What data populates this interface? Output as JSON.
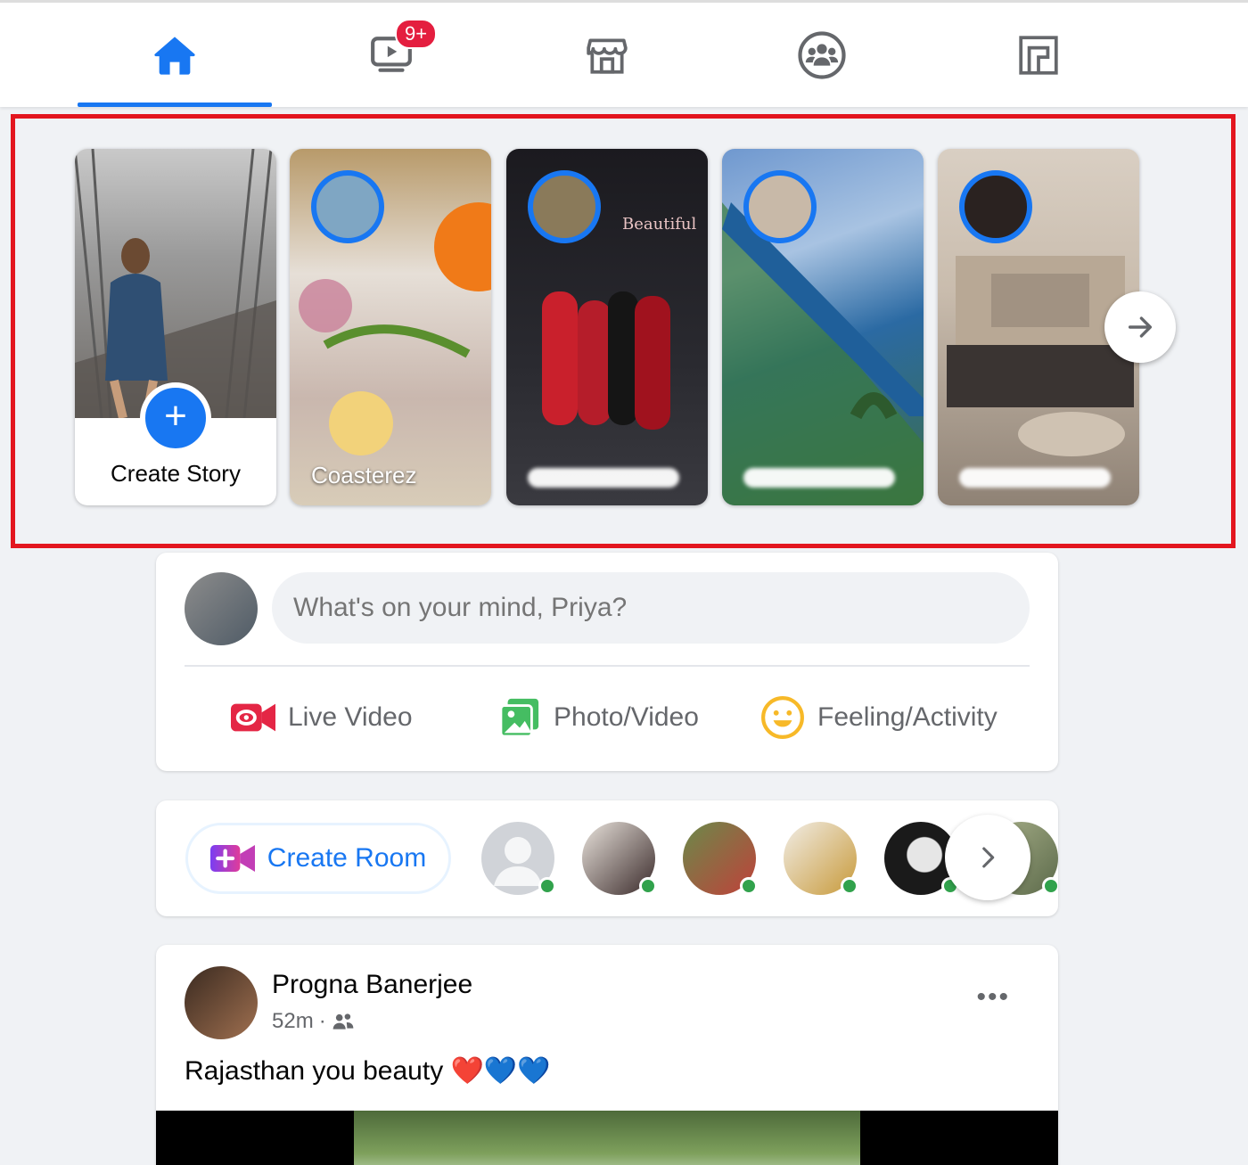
{
  "nav": {
    "tabs": [
      {
        "name": "home",
        "icon": "home-icon",
        "active": true
      },
      {
        "name": "watch",
        "icon": "video-icon",
        "badge": "9+"
      },
      {
        "name": "marketplace",
        "icon": "store-icon"
      },
      {
        "name": "groups",
        "icon": "groups-icon"
      },
      {
        "name": "gaming",
        "icon": "gaming-icon"
      }
    ],
    "accent": "#1877f2",
    "badge_color": "#e41e3f"
  },
  "stories": {
    "create_label": "Create Story",
    "items": [
      {
        "name": "Coasterez",
        "blurred": false
      },
      {
        "name": "",
        "blurred": true
      },
      {
        "name": "",
        "blurred": true
      },
      {
        "name": "",
        "blurred": true
      }
    ]
  },
  "composer": {
    "placeholder": "What's on your mind, Priya?",
    "actions": {
      "live": "Live Video",
      "photo": "Photo/Video",
      "feeling": "Feeling/Activity"
    },
    "colors": {
      "live": "#e42645",
      "photo": "#45bd62",
      "feeling": "#f7b928"
    }
  },
  "rooms": {
    "create_label": "Create Room",
    "online_color": "#31a24c"
  },
  "post": {
    "author": "Progna Banerjee",
    "time": "52m",
    "text": "Rajasthan you beauty ❤️💙💙"
  }
}
